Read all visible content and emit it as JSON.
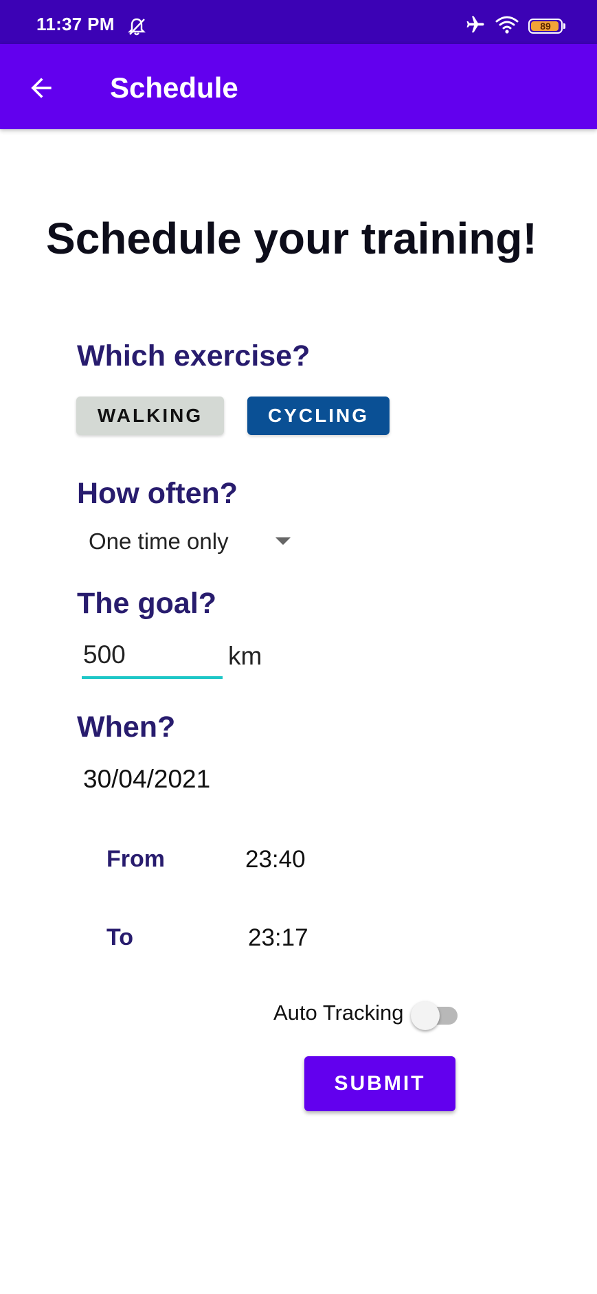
{
  "status_bar": {
    "time": "11:37 PM",
    "battery_level": "89",
    "icons": [
      "bell-off-icon",
      "airplane-icon",
      "wifi-icon",
      "battery-icon"
    ],
    "background_color": "#3c02b5",
    "battery_color": "#f2a437"
  },
  "app_bar": {
    "title": "Schedule",
    "back_icon": "arrow-back-icon",
    "background_color": "#6200ee"
  },
  "page": {
    "heading": "Schedule your training!"
  },
  "exercise": {
    "label": "Which exercise?",
    "options": [
      {
        "label": "WALKING",
        "selected": false,
        "color": "#d4d9d4"
      },
      {
        "label": "CYCLING",
        "selected": true,
        "color": "#0a5095"
      }
    ]
  },
  "frequency": {
    "label": "How often?",
    "value": "One time only"
  },
  "goal": {
    "label": "The goal?",
    "value": "500",
    "unit": "km"
  },
  "when": {
    "label": "When?",
    "date": "30/04/2021",
    "from_label": "From",
    "from_time": "23:40",
    "to_label": "To",
    "to_time": "23:17"
  },
  "auto_tracking": {
    "label": "Auto Tracking",
    "enabled": false
  },
  "submit": {
    "label": "SUBMIT",
    "color": "#6200ee"
  },
  "colors": {
    "section_label": "#281c6e",
    "input_underline": "#1ec7c7"
  }
}
